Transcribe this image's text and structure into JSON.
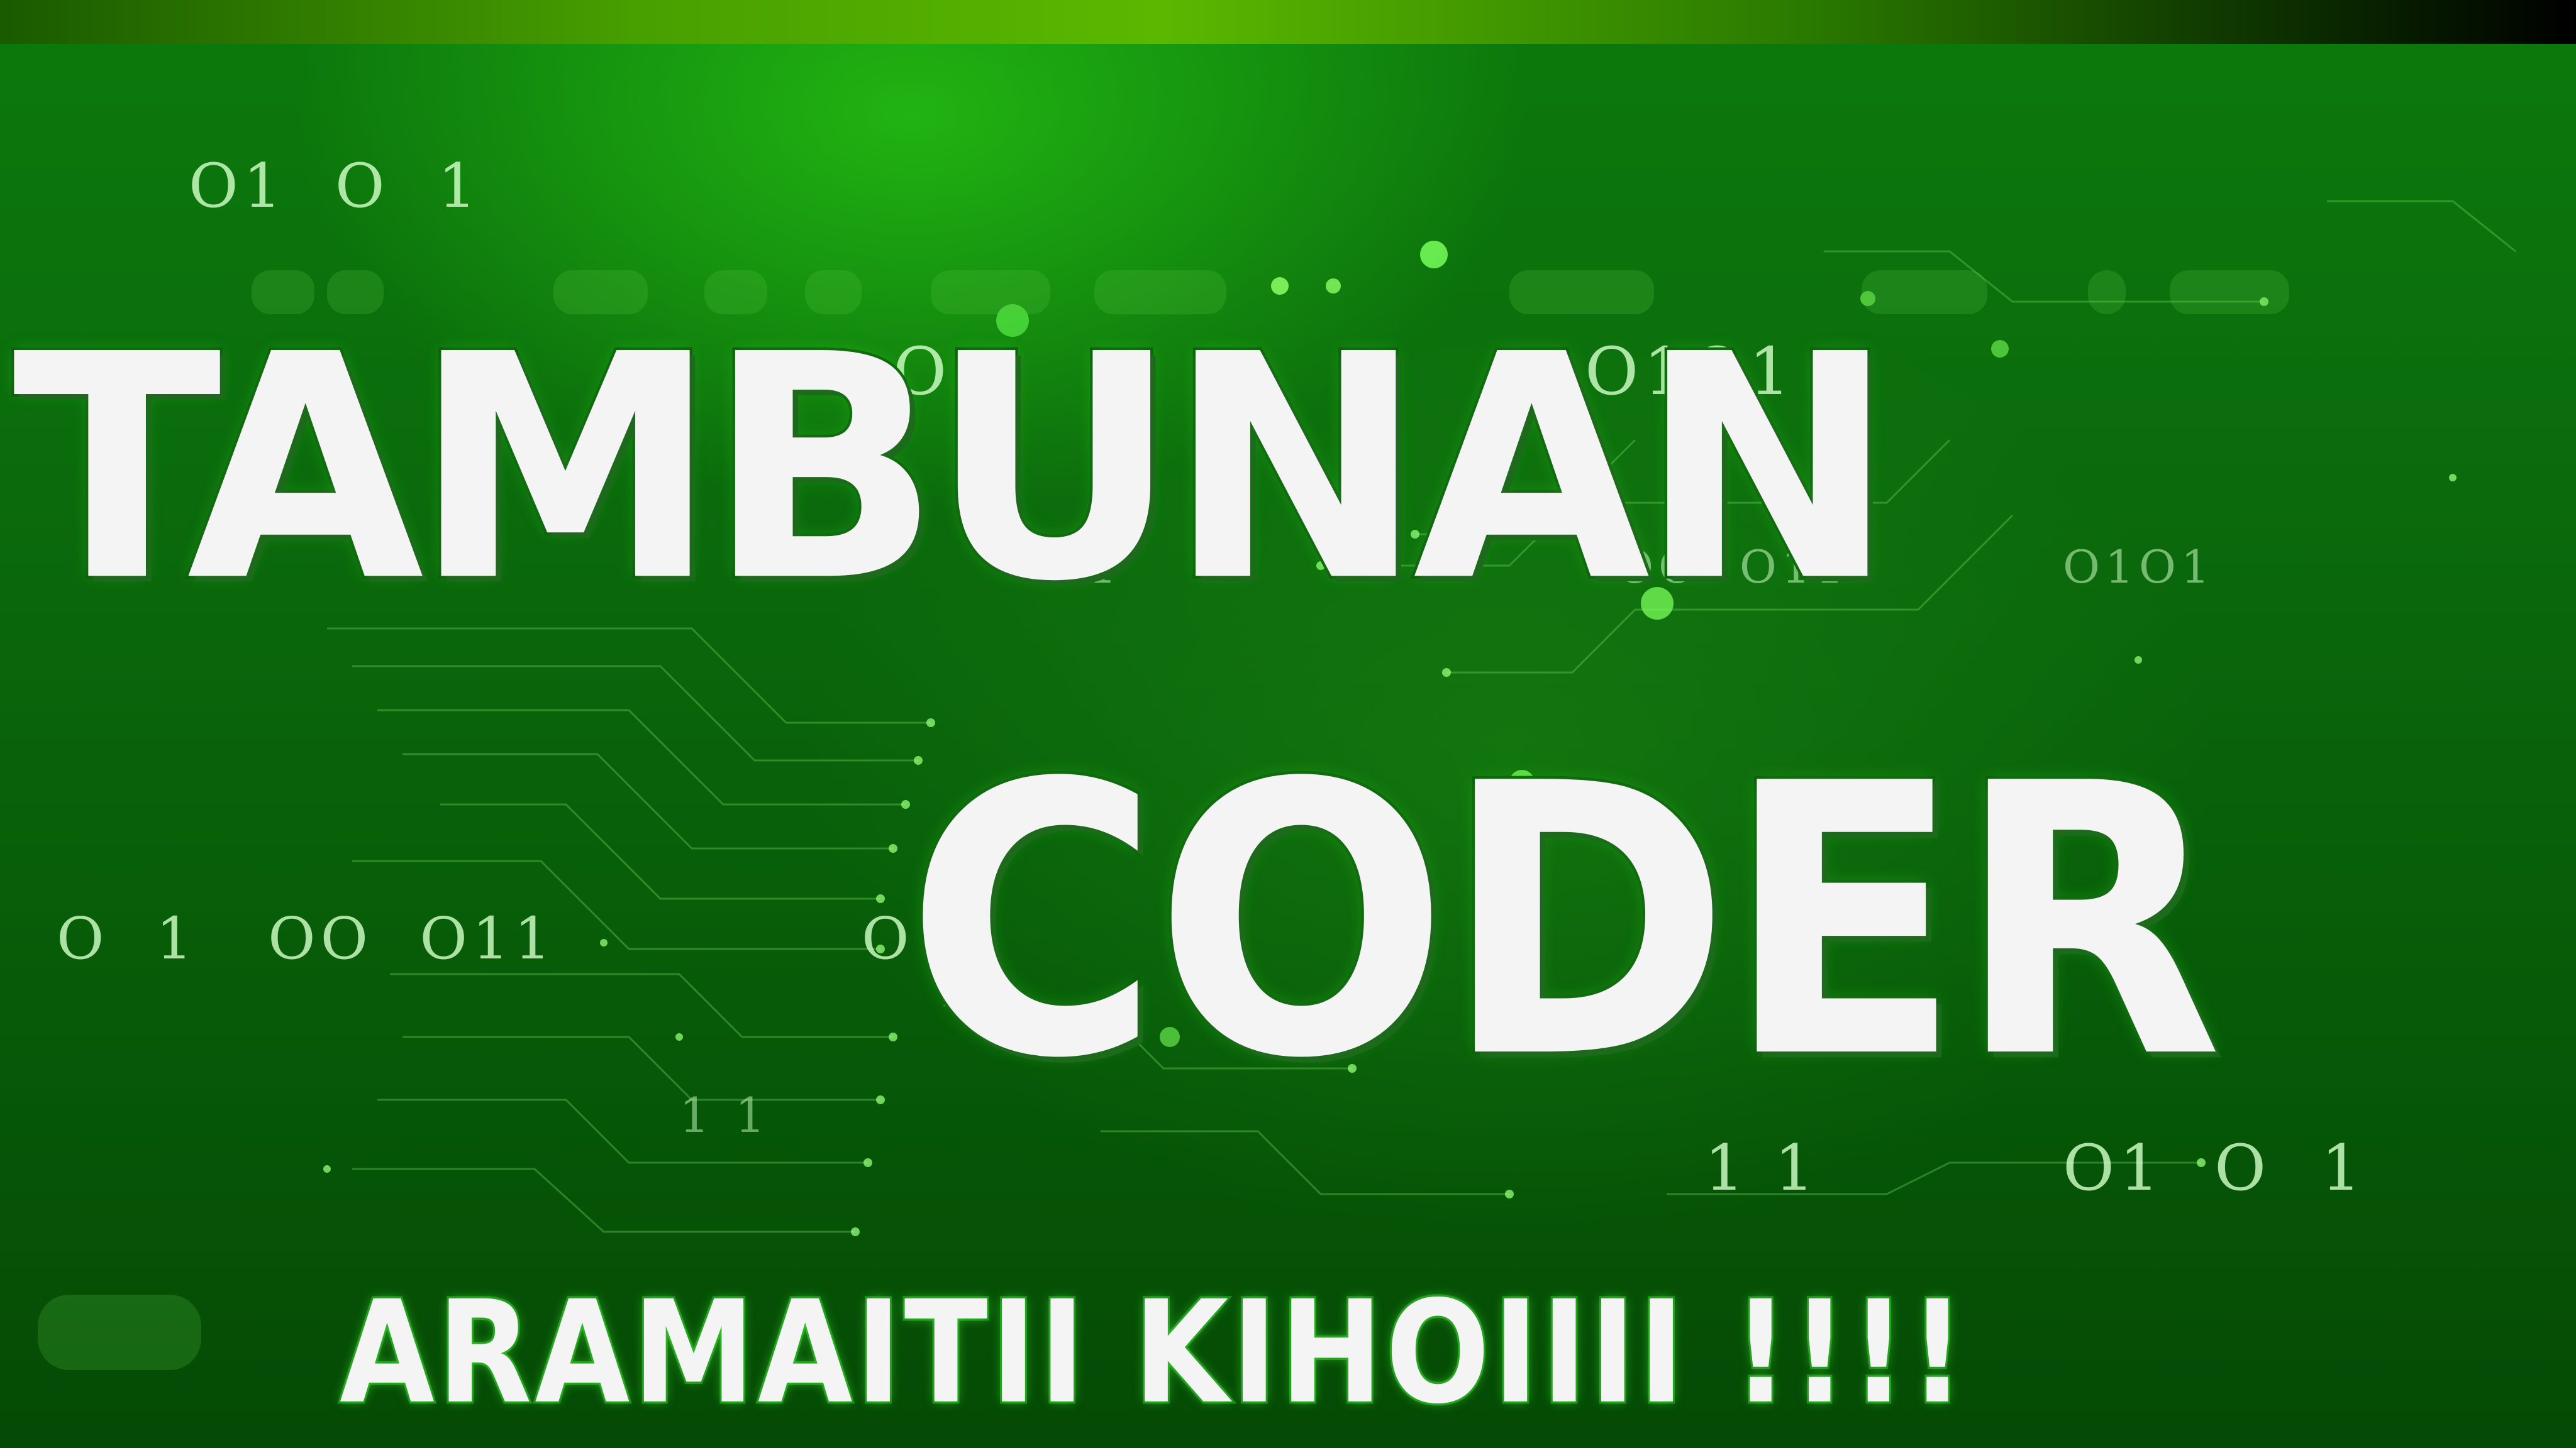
{
  "colors": {
    "background_dark": "#054a05",
    "background_light": "#0c7a0c",
    "glow": "#33ff22",
    "title_fill": "#f4f4f4",
    "title_outline": "#0c5a0c"
  },
  "background": {
    "binary_fragments": [
      "O1  O  1",
      "O",
      "O1O1",
      "1",
      "OO  O11",
      "O1O1",
      "O  1   OO  O11",
      "O  1",
      "1 1",
      "1 1",
      "O1  O  1"
    ]
  },
  "title": {
    "line1": "TAMBUNAN",
    "line2": "CODER"
  },
  "tagline": "ARAMAITII KIHOIIII !!!!"
}
